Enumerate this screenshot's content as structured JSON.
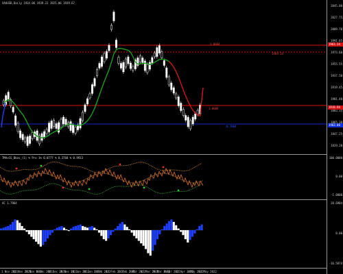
{
  "main": {
    "symbol_header": "XAUUSD,Daily 1934.06 1939.22 1925.06 1939.67",
    "level_high_label": "1.0004",
    "level_high_value": "1969.14",
    "level_mid_label": "1.0004",
    "level_low_label": "0.1904",
    "price_tag": "1918.94",
    "support_tag": "1903.00",
    "res_tag": "1963.34"
  },
  "bands": {
    "header": "TMA+CG_Bkov_(1) % Pro 1% 0.0777 % 0.3768 % 0.9933"
  },
  "ac": {
    "header": "AC 1.7964"
  },
  "price_scale": [
    "2045.80",
    "2027.75",
    "2009.70",
    "1991.65",
    "1973.60",
    "1955.55",
    "1937.50",
    "1919.45",
    "1901.40",
    "1883.35",
    "1865.30",
    "1847.25",
    "1829.20"
  ],
  "band_scale": [
    "100.0000",
    "0.00",
    "-1.0000"
  ],
  "ac_scale": [
    "28.6904",
    "0.00",
    "-16.5874"
  ],
  "time_axis": [
    "1 Nov 2021",
    "11 Nov 2021",
    "23 Nov 2021",
    "6 Dec 2021",
    "16 Dec 2021",
    "28 Dec 2021",
    "10 Jan 2022",
    "20 Jan 2022",
    "1 Feb 2022",
    "11 Feb 2022",
    "23 Feb 2022",
    "7 Mar 2022",
    "17 Mar 2022",
    "29 Mar 2022",
    "8 Apr 2022",
    "21 Apr 2022",
    "3 May 2022",
    "13 May 2022"
  ],
  "colors": {
    "bull": "#ffffff",
    "bear": "#ffffff",
    "ma_up": "#1e9d1e",
    "ma_down": "#d01818",
    "res_line": "#e01010",
    "sup_line": "#1020d0",
    "ac_up": "#1f3fff",
    "ac_down": "#ffffff"
  }
}
